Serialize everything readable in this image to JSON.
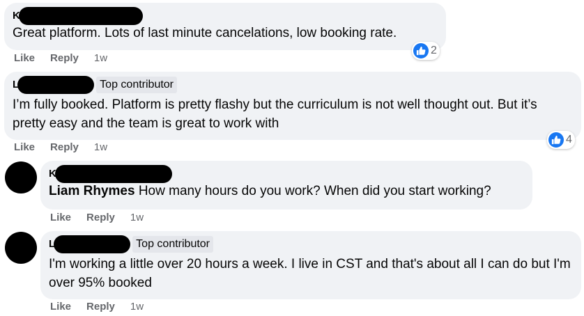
{
  "comments": [
    {
      "author": "K",
      "badge": "",
      "text": "Great platform. Lots of last minute cancelations, low booking rate.",
      "mention": "",
      "like": "Like",
      "reply": "Reply",
      "time": "1w",
      "reactions": "2"
    },
    {
      "author": "L",
      "badge": "Top contributor",
      "text": "I’m fully booked. Platform is pretty flashy but the curriculum is not well thought out. But it’s pretty easy and the team is great to work with",
      "mention": "",
      "like": "Like",
      "reply": "Reply",
      "time": "1w",
      "reactions": "4"
    },
    {
      "author": "K",
      "badge": "",
      "mention": "Liam Rhymes",
      "text": " How many hours do you work? When did you start working?",
      "like": "Like",
      "reply": "Reply",
      "time": "1w",
      "reactions": ""
    },
    {
      "author": "L",
      "badge": "Top contributor",
      "mention": "",
      "text": "I'm working a little over 20 hours a week. I live in CST and that's about all I can do but I'm over 95% booked",
      "like": "Like",
      "reply": "Reply",
      "time": "1w",
      "reactions": ""
    }
  ],
  "colors": {
    "bubble": "#f0f2f5",
    "like_blue": "#1877f2",
    "meta_grey": "#65676b"
  },
  "icons": {
    "reaction": "thumbs-up-icon",
    "avatar": "avatar-redacted"
  }
}
